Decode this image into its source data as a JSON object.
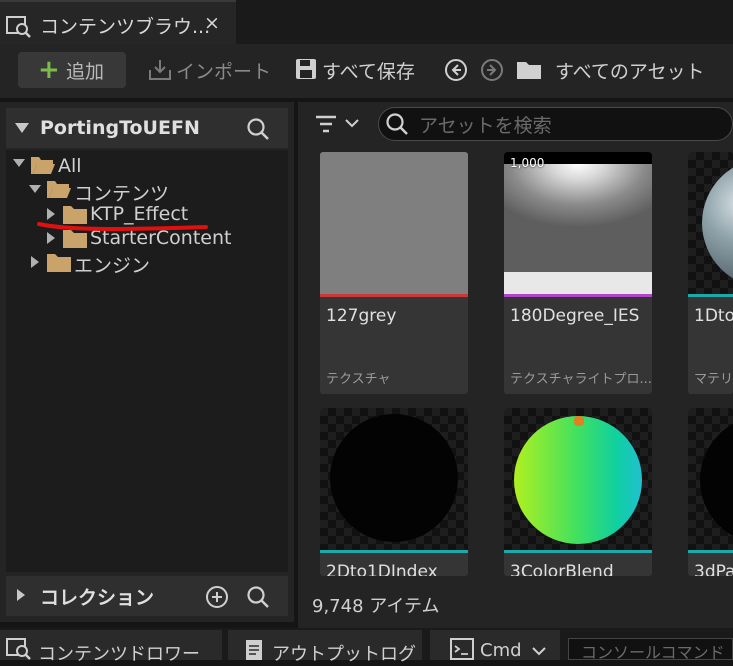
{
  "tab": {
    "title": "コンテンツブラウ...",
    "close": "×"
  },
  "toolbar": {
    "add_label": "追加",
    "add_plus": "+",
    "import_label": "インポート",
    "save_all_label": "すべて保存",
    "path_label": "すべてのアセット"
  },
  "left": {
    "title": "PortingToUEFN",
    "tree": [
      "All",
      "コンテンツ",
      "KTP_Effect",
      "StarterContent",
      "エンジン"
    ],
    "collection_label": "コレクション"
  },
  "search": {
    "placeholder": "アセットを検索"
  },
  "assets": [
    {
      "name": "127grey",
      "type": "テクスチャ",
      "color": "#c83a3a"
    },
    {
      "name": "180Degree_IES",
      "type": "テクスチャライトプロ...",
      "color": "#b045c8",
      "badge": "1,000"
    },
    {
      "name": "1Dto:",
      "type": "マテリア",
      "color": "#1fa8a8"
    },
    {
      "name": "2Dto1DIndex",
      "color": "#1fa8a8"
    },
    {
      "name": "3ColorBlend",
      "color": "#1fa8a8"
    },
    {
      "name": "3dPa",
      "color": "#1fa8a8"
    }
  ],
  "status": {
    "count": "9,748 アイテム"
  },
  "bottom": {
    "content_drawer": "コンテンツドロワー",
    "output_log": "アウトプットログ",
    "cmd": "Cmd",
    "console_placeholder": "コンソールコマンド"
  },
  "colors": {
    "accent_green": "#7dbb4d",
    "folder": "#c9a36a",
    "annotation_red": "#e01010"
  }
}
